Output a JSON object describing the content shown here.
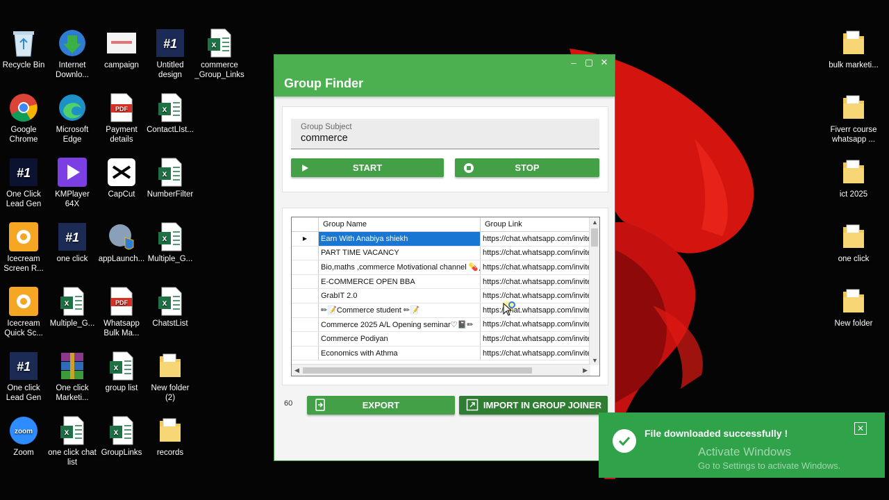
{
  "desktop_left": [
    {
      "label": "Recycle Bin",
      "icon": "recycle-bin-icon",
      "color": "#9ec8e8"
    },
    {
      "label": "Internet Downlo...",
      "icon": "internet-download-manager-icon",
      "color": "#2e7dd2"
    },
    {
      "label": "campaign",
      "icon": "image-file-icon",
      "color": "#f4f4f4"
    },
    {
      "label": "Untitled design",
      "icon": "one-click-icon",
      "color": "#1b2b55"
    },
    {
      "label": "commerce _Group_Links",
      "icon": "excel-icon",
      "color": "#1e7145"
    },
    {
      "label": "Google Chrome",
      "icon": "chrome-icon",
      "color": "#db4437"
    },
    {
      "label": "Microsoft Edge",
      "icon": "edge-icon",
      "color": "#1e90c8"
    },
    {
      "label": "Payment details",
      "icon": "pdf-icon",
      "color": "#d93025"
    },
    {
      "label": "ContactLIst...",
      "icon": "excel-icon",
      "color": "#1e7145"
    },
    {
      "label": "One Click Lead Gen",
      "icon": "lead-gen-icon",
      "color": "#0c1330"
    },
    {
      "label": "KMPlayer 64X",
      "icon": "kmplayer-icon",
      "color": "#7b3fe4"
    },
    {
      "label": "CapCut",
      "icon": "capcut-icon",
      "color": "#ffffff"
    },
    {
      "label": "NumberFilter",
      "icon": "excel-icon",
      "color": "#1e7145"
    },
    {
      "label": "Icecream Screen R...",
      "icon": "icecream-recorder-icon",
      "color": "#f5a623"
    },
    {
      "label": "one click",
      "icon": "one-click-icon",
      "color": "#1b2b55"
    },
    {
      "label": "appLaunch...",
      "icon": "app-launcher-icon",
      "color": "#8aa0b8"
    },
    {
      "label": "Multiple_G...",
      "icon": "excel-icon",
      "color": "#1e7145"
    },
    {
      "label": "Icecream Quick Sc...",
      "icon": "icecream-screenshot-icon",
      "color": "#f5a623"
    },
    {
      "label": "Multiple_G...",
      "icon": "excel-icon",
      "color": "#1e7145"
    },
    {
      "label": "Whatsapp Bulk Ma...",
      "icon": "pdf-icon",
      "color": "#d93025"
    },
    {
      "label": "ChatstList",
      "icon": "excel-icon",
      "color": "#1e7145"
    },
    {
      "label": "One click Lead Gen",
      "icon": "one-click-icon",
      "color": "#1b2b55"
    },
    {
      "label": "One click Marketi...",
      "icon": "winrar-icon",
      "color": "#8b3a8b"
    },
    {
      "label": "group list",
      "icon": "excel-icon",
      "color": "#1e7145"
    },
    {
      "label": "New folder (2)",
      "icon": "folder-icon",
      "color": "#f2c94c"
    },
    {
      "label": "Zoom",
      "icon": "zoom-icon",
      "color": "#2d8cff"
    },
    {
      "label": "one click chat list",
      "icon": "excel-csv-icon",
      "color": "#1e7145"
    },
    {
      "label": "GroupLinks",
      "icon": "excel-icon",
      "color": "#1e7145"
    },
    {
      "label": "records",
      "icon": "folder-icon",
      "color": "#f2c94c"
    }
  ],
  "desktop_right": [
    {
      "label": "bulk marketi...",
      "icon": "folder-icon",
      "color": "#f2c94c"
    },
    {
      "label": "Fiverr course whatsapp ...",
      "icon": "folder-icon",
      "color": "#f2c94c"
    },
    {
      "label": "ict 2025",
      "icon": "folder-icon",
      "color": "#f2c94c"
    },
    {
      "label": "one click",
      "icon": "folder-icon",
      "color": "#f2c94c"
    },
    {
      "label": "New folder",
      "icon": "folder-icon",
      "color": "#f2c94c"
    }
  ],
  "window": {
    "title": "Group Finder",
    "controls": {
      "minimize": "–",
      "maximize": "▢",
      "close": "✕"
    },
    "subject_label": "Group Subject",
    "subject_value": "commerce",
    "start_label": "START",
    "stop_label": "STOP",
    "columns": [
      "Group Name",
      "Group Link"
    ],
    "rows": [
      {
        "name": "Earn With Anabiya shiekh",
        "link": "https://chat.whatsapp.com/invite/"
      },
      {
        "name": "PART TIME VACANCY",
        "link": "https://chat.whatsapp.com/invite/"
      },
      {
        "name": "Bio,maths ,commerce Motivational channel 💊🖊👁",
        "link": "https://chat.whatsapp.com/invite/"
      },
      {
        "name": "E-COMMERCE OPEN BBA",
        "link": "https://chat.whatsapp.com/invite/"
      },
      {
        "name": "GrabIT 2.0",
        "link": "https://chat.whatsapp.com/invite/"
      },
      {
        "name": "✏📝Commerce student ✏📝",
        "link": "https://chat.whatsapp.com/invite/"
      },
      {
        "name": "Commerce  2025 A/L Opening seminar♡📓✏",
        "link": "https://chat.whatsapp.com/invite/"
      },
      {
        "name": "Commerce Podiyan",
        "link": "https://chat.whatsapp.com/invite/"
      },
      {
        "name": "Economics with Athma",
        "link": "https://chat.whatsapp.com/invite/"
      }
    ],
    "count": "60",
    "export_label": "EXPORT",
    "import_label": "IMPORT IN GROUP JOINER"
  },
  "toast": {
    "message": "File downloaded successfully !",
    "close": "✕"
  },
  "watermark": {
    "line1": "Activate Windows",
    "line2": "Go to Settings to activate Windows."
  },
  "colors": {
    "accent": "#4caf50",
    "button": "#43a047",
    "selection": "#1976d2",
    "toast": "#2fa24a"
  }
}
